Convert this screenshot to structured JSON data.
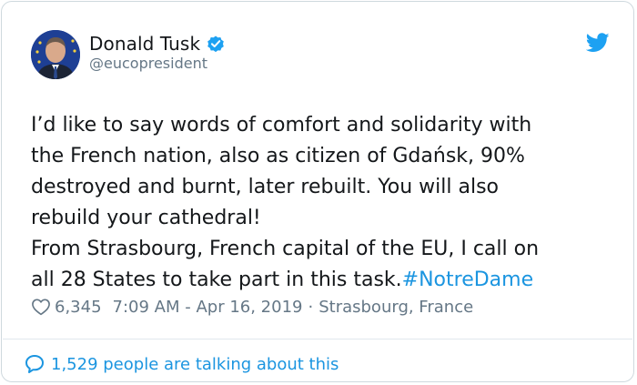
{
  "author": {
    "display_name": "Donald Tusk",
    "handle": "@eucopresident",
    "verified": true,
    "avatar_icon": "avatar-photo"
  },
  "tweet": {
    "line_1": "I’d like to say words of comfort and solidarity with",
    "line_2": "the French nation, also as citizen of Gdańsk, 90%",
    "line_3": "destroyed and burnt, later rebuilt. You will also",
    "line_4": "rebuild your cathedral!",
    "line_5": "From Strasbourg, French capital of the EU, I call on",
    "line_6_text": "all 28 States to take part in this task.",
    "hashtag": "#NotreDame"
  },
  "meta": {
    "likes": "6,345",
    "timestamp": "7:09 AM - Apr 16, 2019",
    "separator": "·",
    "location": "Strasbourg, France"
  },
  "footer": {
    "talking": "1,529 people are talking about this"
  },
  "colors": {
    "link_blue": "#1b95e0",
    "text_dark": "#14171a",
    "text_muted": "#657786",
    "verified_blue": "#1da1f2"
  },
  "icons": {
    "brand": "twitter-bird-icon",
    "verified": "verified-badge-icon",
    "like": "heart-icon",
    "talking": "speech-bubble-icon"
  }
}
